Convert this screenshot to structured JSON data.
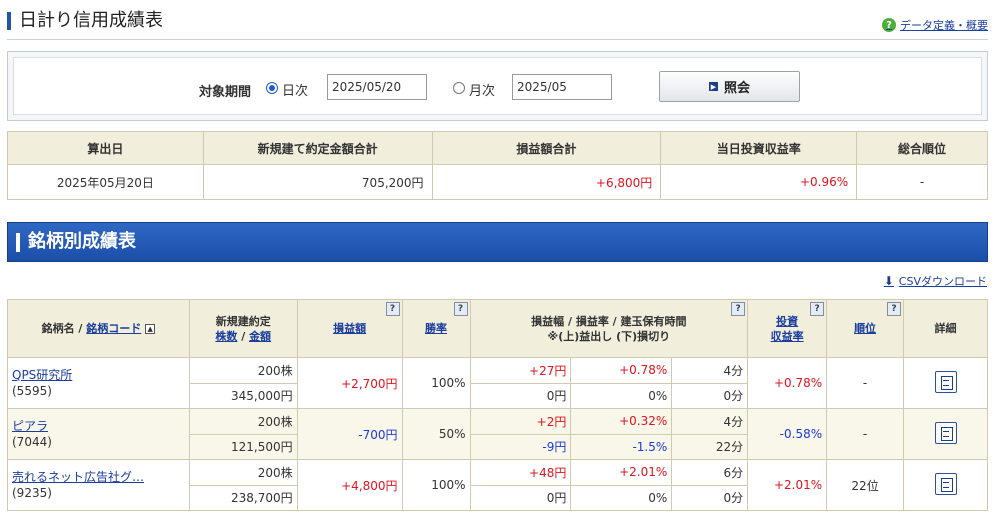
{
  "header": {
    "title": "日計り信用成績表",
    "help_label": "データ定義・概要",
    "help_icon": "?"
  },
  "search": {
    "period_label": "対象期間",
    "daily_label": "日次",
    "daily_value": "2025/05/20",
    "monthly_label": "月次",
    "monthly_value": "2025/05",
    "submit_label": "照会",
    "selected": "daily"
  },
  "summary": {
    "headers": [
      "算出日",
      "新規建て約定金額合計",
      "損益額合計",
      "当日投資収益率",
      "総合順位"
    ],
    "values": [
      "2025年05月20日",
      "705,200円",
      "+6,800円",
      "+0.96%",
      "-"
    ]
  },
  "section": {
    "title": "銘柄別成績表",
    "csv_label": "CSVダウンロード"
  },
  "table": {
    "h_name": "銘柄名 /",
    "h_code": "銘柄コード",
    "h_contract": "新規建約定",
    "h_shares": "株数",
    "h_slash": "/",
    "h_amount": "金額",
    "h_pl": "損益額",
    "h_winrate": "勝率",
    "h_range": "損益幅 / 損益率 / 建玉保有時間",
    "h_range_note": "※(上)益出し (下)損切り",
    "h_roi1": "投資",
    "h_roi2": "収益率",
    "h_rank": "順位",
    "h_detail": "詳細",
    "qmark": "?",
    "sort_icon": "▲",
    "rows": [
      {
        "name": "QPS研究所",
        "code": "(5595)",
        "shares": "200株",
        "amount": "345,000円",
        "pl": "+2,700円",
        "winrate": "100%",
        "up_range": "+27円",
        "up_rate": "+0.78%",
        "up_time": "4分",
        "dn_range": "0円",
        "dn_rate": "0%",
        "dn_time": "0分",
        "roi": "+0.78%",
        "rank": "-"
      },
      {
        "name": "ピアラ",
        "code": "(7044)",
        "shares": "200株",
        "amount": "121,500円",
        "pl": "-700円",
        "winrate": "50%",
        "up_range": "+2円",
        "up_rate": "+0.32%",
        "up_time": "4分",
        "dn_range": "-9円",
        "dn_rate": "-1.5%",
        "dn_time": "22分",
        "roi": "-0.58%",
        "rank": "-"
      },
      {
        "name": "売れるネット広告社グ…",
        "code": "(9235)",
        "shares": "200株",
        "amount": "238,700円",
        "pl": "+4,800円",
        "winrate": "100%",
        "up_range": "+48円",
        "up_rate": "+2.01%",
        "up_time": "6分",
        "dn_range": "0円",
        "dn_rate": "0%",
        "dn_time": "0分",
        "roi": "+2.01%",
        "rank": "22位"
      }
    ]
  }
}
